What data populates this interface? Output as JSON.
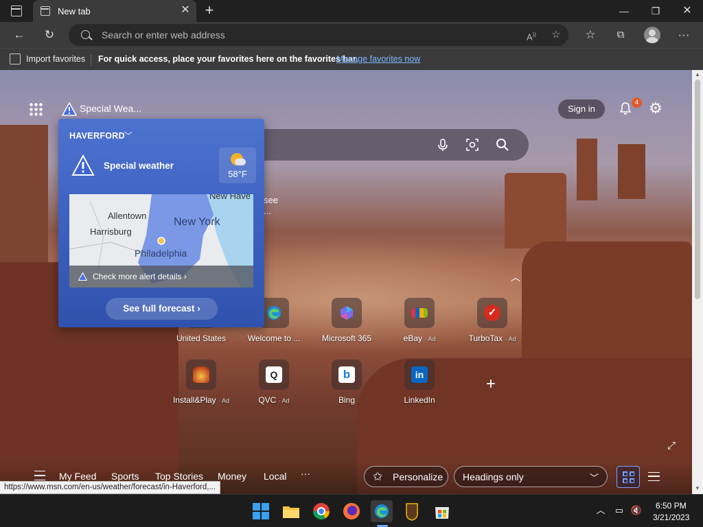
{
  "browser": {
    "tab_title": "New tab",
    "address_placeholder": "Search or enter web address"
  },
  "favorites_bar": {
    "import_label": "Import favorites",
    "message": "For quick access, place your favorites here on the favorites bar.",
    "link": "Manage favorites now"
  },
  "page": {
    "weather_alert_short": "Special Wea...",
    "sign_in": "Sign in",
    "notification_count": "4",
    "behind_text_1": "see",
    "behind_text_2": "..."
  },
  "weather_flyout": {
    "location": "HAVERFORD",
    "headline": "Special weather",
    "temperature": "58°F",
    "map_labels": [
      "New Have",
      "Allentown",
      "New York",
      "Harrisburg",
      "Philadelphia"
    ],
    "alert_details": "Check more alert details",
    "forecast_button": "See full forecast"
  },
  "quick_links": [
    {
      "label": "United States",
      "ad": "",
      "icon": "united-states-icon"
    },
    {
      "label": "Welcome to ...",
      "ad": "",
      "icon": "edge-icon"
    },
    {
      "label": "Microsoft 365",
      "ad": "",
      "icon": "microsoft-365-icon"
    },
    {
      "label": "eBay",
      "ad": "· Ad",
      "icon": "ebay-icon"
    },
    {
      "label": "TurboTax",
      "ad": "· Ad",
      "icon": "turbotax-icon"
    },
    {
      "label": "Install&Play",
      "ad": "· Ad",
      "icon": "install-play-icon"
    },
    {
      "label": "QVC",
      "ad": "· Ad",
      "icon": "qvc-icon"
    },
    {
      "label": "Bing",
      "ad": "",
      "icon": "bing-icon"
    },
    {
      "label": "LinkedIn",
      "ad": "",
      "icon": "linkedin-icon"
    }
  ],
  "feed_nav": {
    "tabs": [
      "My Feed",
      "Sports",
      "Top Stories",
      "Money",
      "Local"
    ],
    "more": "···",
    "personalize": "Personalize",
    "headings_option": "Headings only"
  },
  "status_url": "https://www.msn.com/en-us/weather/forecast/in-Haverford,...",
  "taskbar": {
    "time": "6:50 PM",
    "date": "3/21/2023"
  },
  "colors": {
    "accent": "#7cb8ff",
    "flyout_blue": "#3e62c2",
    "badge": "#e05a2a"
  }
}
